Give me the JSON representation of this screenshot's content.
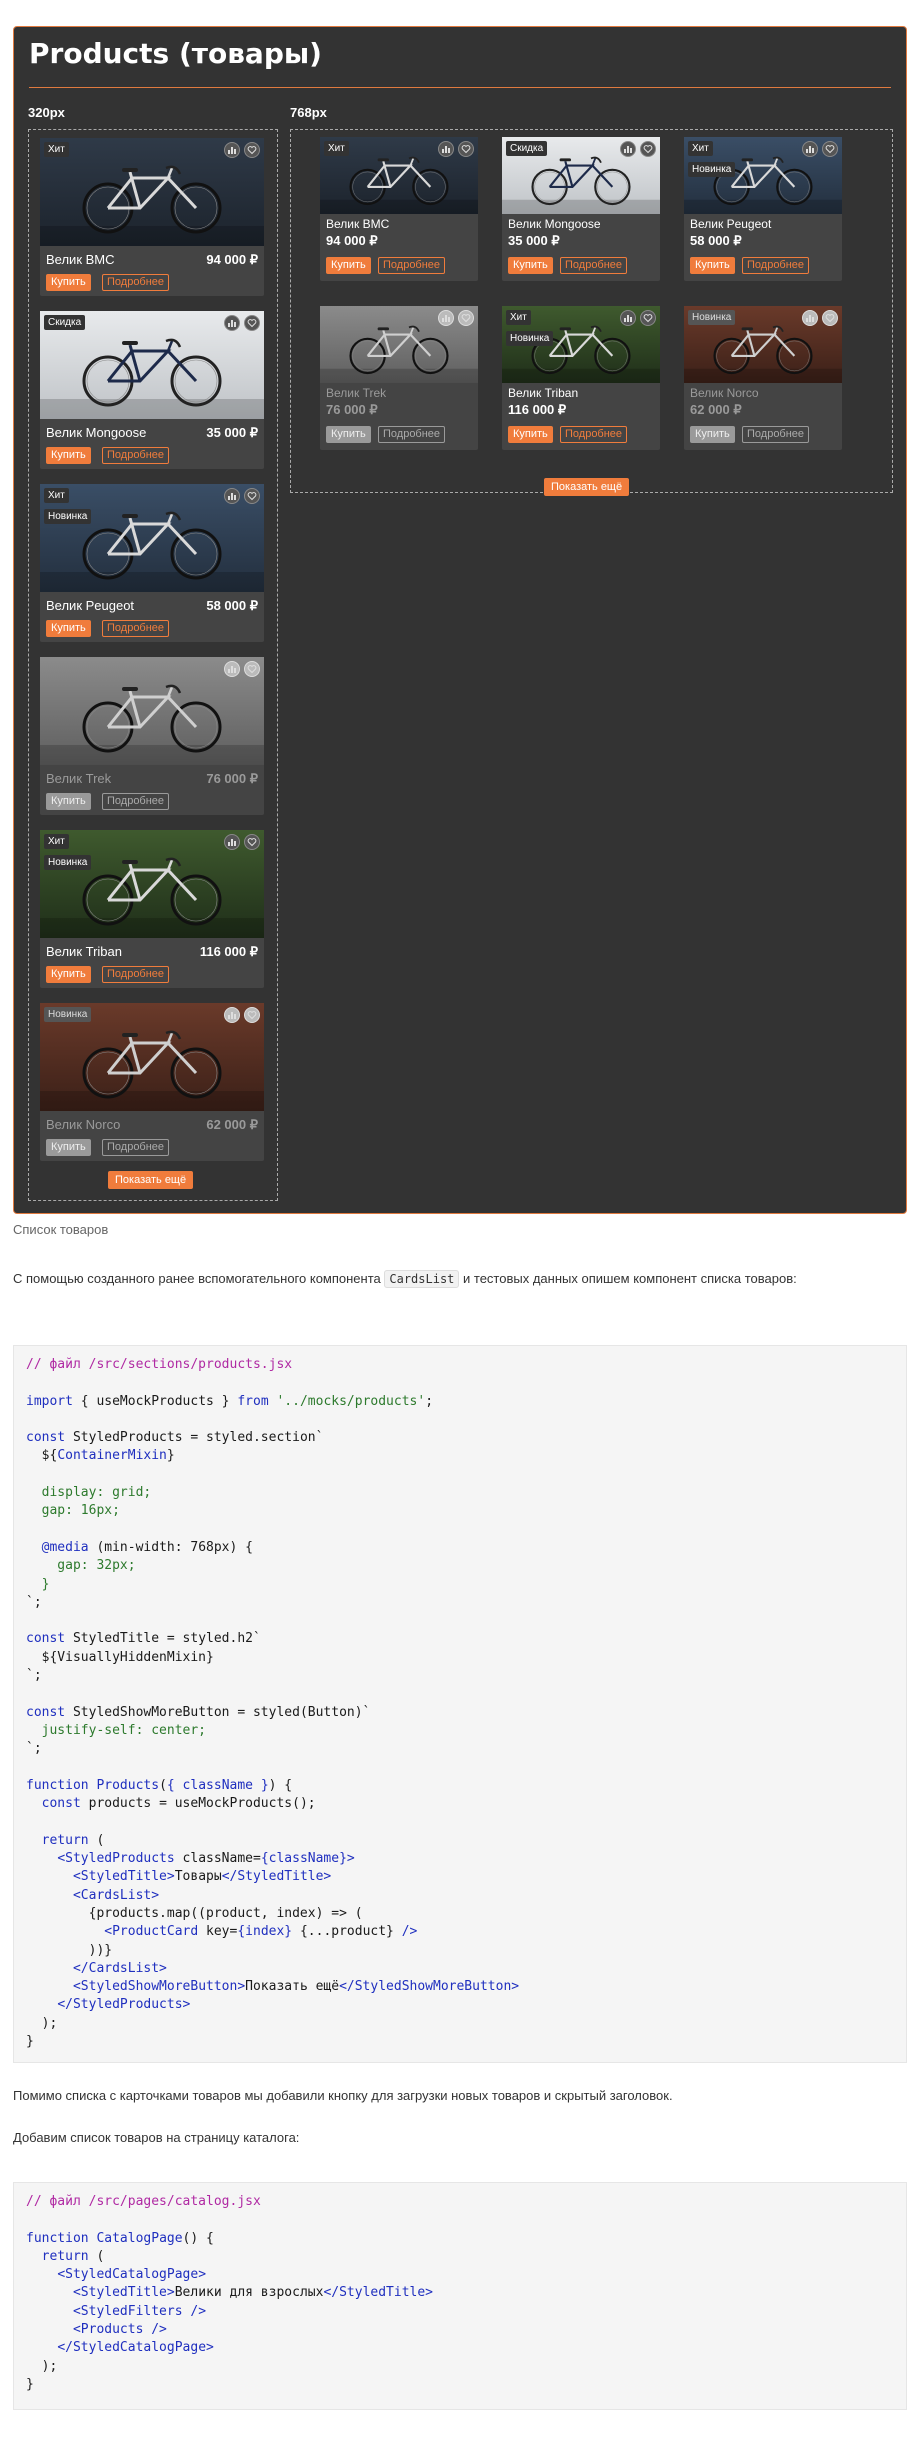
{
  "demo": {
    "title": "Products (товары)",
    "bp_small": "320px",
    "bp_large": "768px",
    "show_more_label": "Показать ещё",
    "buy_label": "Купить",
    "more_label": "Подробнее"
  },
  "products": [
    {
      "name": "Велик BMC",
      "price": "94 000 ₽",
      "badges": [
        "Хит"
      ],
      "available": true,
      "photo": "dark-blue"
    },
    {
      "name": "Велик Mongoose",
      "price": "35 000 ₽",
      "badges": [
        "Скидка"
      ],
      "available": true,
      "photo": "white-wall"
    },
    {
      "name": "Велик Peugeot",
      "price": "58 000 ₽",
      "badges": [
        "Хит",
        "Новинка"
      ],
      "available": true,
      "photo": "blue-wall"
    },
    {
      "name": "Велик Trek",
      "price": "76 000 ₽",
      "badges": [],
      "available": false,
      "photo": "grey-wall"
    },
    {
      "name": "Велик Triban",
      "price": "116 000 ₽",
      "badges": [
        "Хит",
        "Новинка"
      ],
      "available": true,
      "photo": "green"
    },
    {
      "name": "Велик Norco",
      "price": "62 000 ₽",
      "badges": [
        "Новинка"
      ],
      "available": false,
      "photo": "brick"
    }
  ],
  "article": {
    "caption": "Список товаров",
    "intro_before": "С помощью созданного ранее вспомогательного компонента ",
    "intro_code": "CardsList",
    "intro_after": " и тестовых данных опишем компонент списка товаров:",
    "para2": "Помимо списка с карточками товаров мы добавили кнопку для загрузки новых товаров и скрытый заголовок.",
    "para3": "Добавим список товаров на страницу каталога:"
  },
  "code1": [
    [
      [
        "com",
        "// файл /src/sections/products.jsx"
      ]
    ],
    [],
    [
      [
        "kw",
        "import"
      ],
      [
        "plain",
        " { useMockProducts } "
      ],
      [
        "kw",
        "from"
      ],
      [
        "plain",
        " "
      ],
      [
        "str",
        "'../mocks/products'"
      ],
      [
        "plain",
        ";"
      ]
    ],
    [],
    [
      [
        "kw",
        "const"
      ],
      [
        "plain",
        " StyledProducts = styled.section`"
      ]
    ],
    [
      [
        "plain",
        "  ${"
      ],
      [
        "fn",
        "ContainerMixin"
      ],
      [
        "plain",
        "}"
      ]
    ],
    [],
    [
      [
        "css",
        "  display: grid;"
      ]
    ],
    [
      [
        "css",
        "  gap: 16px;"
      ]
    ],
    [],
    [
      [
        "kw",
        "  @media"
      ],
      [
        "plain",
        " (min-width: 768px) {"
      ]
    ],
    [
      [
        "css",
        "    gap: 32px;"
      ]
    ],
    [
      [
        "css",
        "  }"
      ]
    ],
    [
      [
        "plain",
        "`;"
      ]
    ],
    [],
    [
      [
        "kw",
        "const"
      ],
      [
        "plain",
        " StyledTitle = styled.h2`"
      ]
    ],
    [
      [
        "plain",
        "  ${VisuallyHiddenMixin}"
      ]
    ],
    [
      [
        "plain",
        "`;"
      ]
    ],
    [],
    [
      [
        "kw",
        "const"
      ],
      [
        "plain",
        " StyledShowMoreButton = styled(Button)`"
      ]
    ],
    [
      [
        "css",
        "  justify-self: center;"
      ]
    ],
    [
      [
        "plain",
        "`;"
      ]
    ],
    [],
    [
      [
        "kw",
        "function"
      ],
      [
        "plain",
        " "
      ],
      [
        "fn",
        "Products"
      ],
      [
        "plain",
        "("
      ],
      [
        "kw",
        "{ className }"
      ],
      [
        "plain",
        ") {"
      ]
    ],
    [
      [
        "plain",
        "  "
      ],
      [
        "kw",
        "const"
      ],
      [
        "plain",
        " products = useMockProducts();"
      ]
    ],
    [],
    [
      [
        "plain",
        "  "
      ],
      [
        "kw",
        "return"
      ],
      [
        "plain",
        " ("
      ]
    ],
    [
      [
        "plain",
        "    "
      ],
      [
        "tag",
        "<StyledProducts"
      ],
      [
        "plain",
        " className="
      ],
      [
        "kw",
        "{className}"
      ],
      [
        "tag",
        ">"
      ]
    ],
    [
      [
        "plain",
        "      "
      ],
      [
        "tag",
        "<StyledTitle>"
      ],
      [
        "plain",
        "Товары"
      ],
      [
        "tag",
        "</StyledTitle>"
      ]
    ],
    [
      [
        "plain",
        "      "
      ],
      [
        "tag",
        "<CardsList>"
      ]
    ],
    [
      [
        "plain",
        "        {products.map((product, index) => ("
      ]
    ],
    [
      [
        "plain",
        "          "
      ],
      [
        "tag",
        "<ProductCard"
      ],
      [
        "plain",
        " key="
      ],
      [
        "kw",
        "{index}"
      ],
      [
        "plain",
        " {...product} "
      ],
      [
        "tag",
        "/>"
      ]
    ],
    [
      [
        "plain",
        "        ))}"
      ]
    ],
    [
      [
        "plain",
        "      "
      ],
      [
        "tag",
        "</CardsList>"
      ]
    ],
    [
      [
        "plain",
        "      "
      ],
      [
        "tag",
        "<StyledShowMoreButton>"
      ],
      [
        "plain",
        "Показать ещё"
      ],
      [
        "tag",
        "</StyledShowMoreButton>"
      ]
    ],
    [
      [
        "plain",
        "    "
      ],
      [
        "tag",
        "</StyledProducts>"
      ]
    ],
    [
      [
        "plain",
        "  );"
      ]
    ],
    [
      [
        "plain",
        "}"
      ]
    ]
  ],
  "code2": [
    [
      [
        "com",
        "// файл /src/pages/catalog.jsx"
      ]
    ],
    [],
    [
      [
        "kw",
        "function"
      ],
      [
        "plain",
        " "
      ],
      [
        "fn",
        "CatalogPage"
      ],
      [
        "plain",
        "() {"
      ]
    ],
    [
      [
        "plain",
        "  "
      ],
      [
        "kw",
        "return"
      ],
      [
        "plain",
        " ("
      ]
    ],
    [
      [
        "plain",
        "    "
      ],
      [
        "tag",
        "<StyledCatalogPage>"
      ]
    ],
    [
      [
        "plain",
        "      "
      ],
      [
        "tag",
        "<StyledTitle>"
      ],
      [
        "plain",
        "Велики для взрослых"
      ],
      [
        "tag",
        "</StyledTitle>"
      ]
    ],
    [
      [
        "plain",
        "      "
      ],
      [
        "tag",
        "<StyledFilters />"
      ]
    ],
    [
      [
        "plain",
        "      "
      ],
      [
        "tag",
        "<Products />"
      ]
    ],
    [
      [
        "plain",
        "    "
      ],
      [
        "tag",
        "</StyledCatalogPage>"
      ]
    ],
    [
      [
        "plain",
        "  );"
      ]
    ],
    [
      [
        "plain",
        "}"
      ]
    ]
  ]
}
